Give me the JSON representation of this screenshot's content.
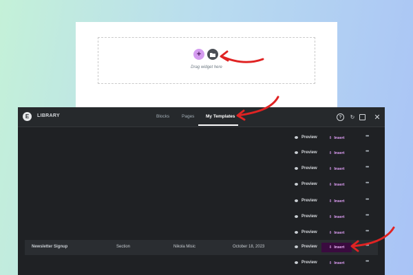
{
  "editor": {
    "add_symbol": "+",
    "drag_text": "Drag widget here"
  },
  "library": {
    "logo_symbol": "E",
    "title": "LIBRARY",
    "tabs": [
      "Blocks",
      "Pages",
      "My Templates"
    ],
    "active_tab": "My Templates",
    "help_symbol": "?",
    "sync_symbol": "↻",
    "close_symbol": "✕",
    "preview_label": "Preview",
    "insert_label": "Insert",
    "insert_symbol": "⇩",
    "more_symbol": "•••",
    "rows": [
      {
        "name": "Newsletter Signup",
        "type": "Section",
        "author": "Nikola Misic",
        "date": "October 18, 2023",
        "highlighted": true
      }
    ]
  },
  "colors": {
    "modal_bg": "#1f2124",
    "topbar_bg": "#26292c",
    "insert_bg": "#3a0b3f",
    "insert_text": "#f2b8ff",
    "annotation_arrow": "#e02323",
    "add_button": "#d59cf0"
  }
}
